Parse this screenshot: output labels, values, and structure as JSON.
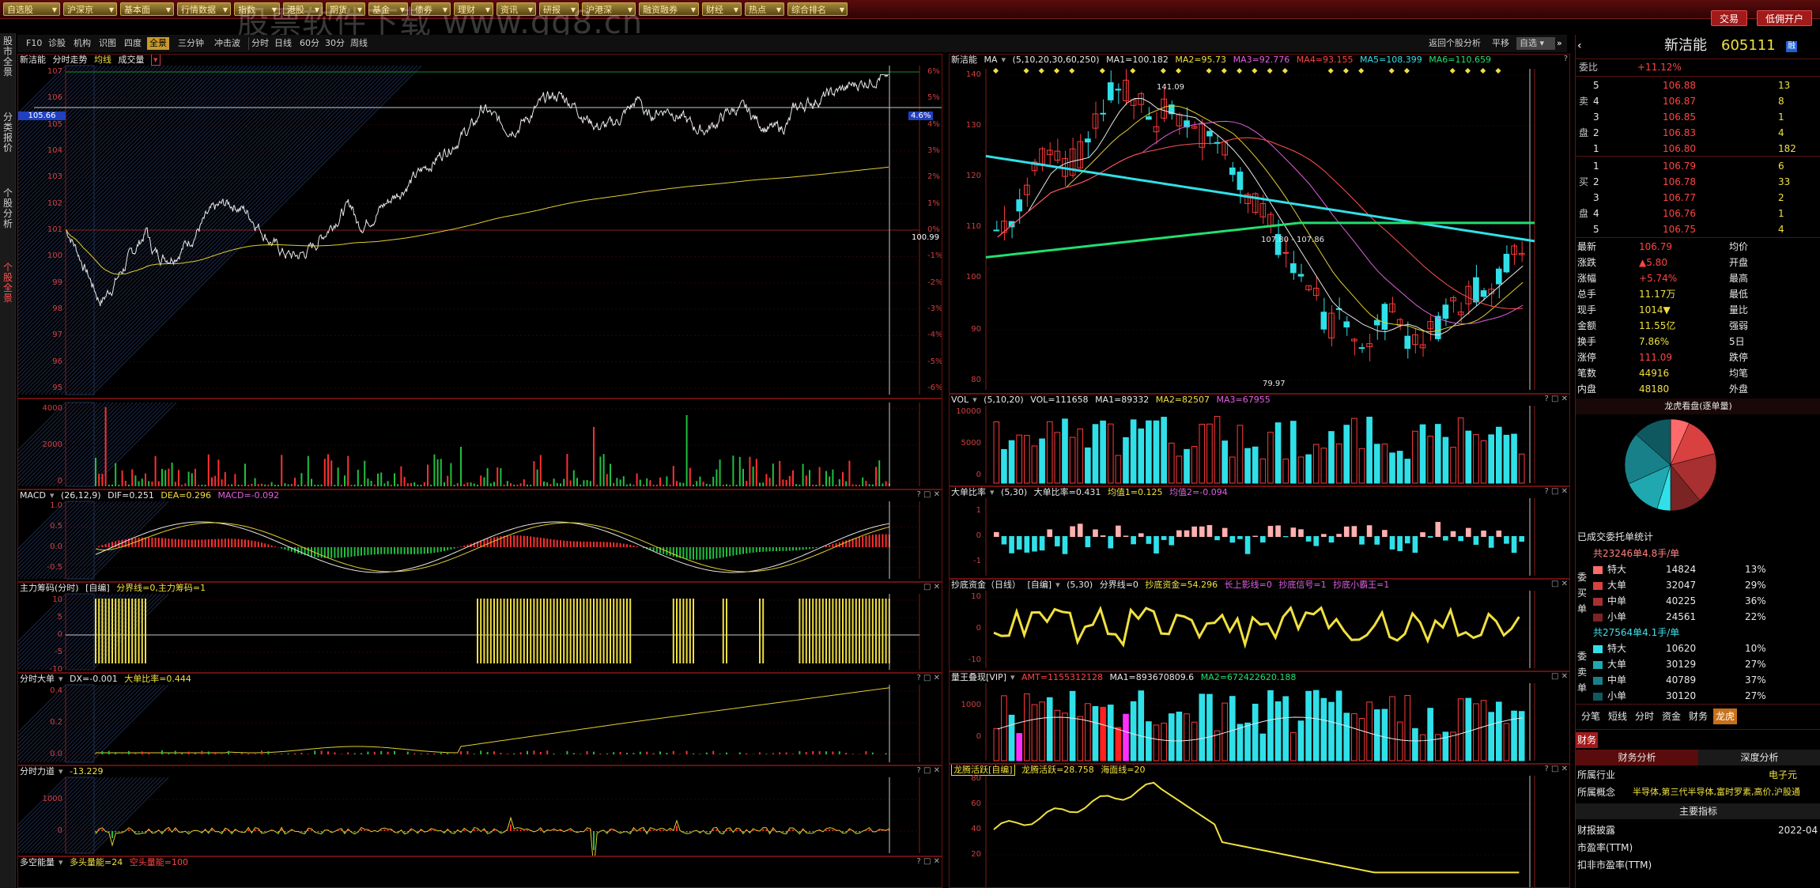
{
  "menubar": {
    "items": [
      "自选股",
      "沪深京",
      "基本面",
      "行情数据",
      "指数",
      "港股",
      "期货",
      "基金",
      "债券",
      "理财",
      "资讯",
      "研报",
      "沪港深",
      "融资融券",
      "财经",
      "热点",
      "综合排名"
    ],
    "watermark": "股票软件下载 www.gg8.cn",
    "trade_button": "交易",
    "lowfee_button": "低佣开户"
  },
  "left_tabs": [
    "股市全景",
    "分类报价",
    "个股分析",
    "个股全景"
  ],
  "toolbar": {
    "items": [
      "F10",
      "诊股",
      "机构",
      "识图",
      "四度",
      "全景",
      "三分钟",
      "冲击波",
      "分时",
      "日线",
      "60分",
      "30分",
      "周线"
    ],
    "active": "全景",
    "right_items": [
      "返回个股分析",
      "平移",
      "自选"
    ]
  },
  "intraday_panel": {
    "title_stock": "新洁能",
    "title_parts": [
      "分时走势",
      "均线",
      "成交量"
    ],
    "price_ticks": [
      "107",
      "106",
      "105",
      "104",
      "103",
      "102",
      "101",
      "100",
      "99",
      "98",
      "97",
      "96",
      "95"
    ],
    "pct_ticks": [
      "6%",
      "5%",
      "4%",
      "3%",
      "2%",
      "1%",
      "0%",
      "-1%",
      "-2%",
      "-3%",
      "-4%",
      "-5%",
      "-6%"
    ],
    "left_marker": "105.66",
    "right_marker": "4.6%",
    "prev_close_label": "100.99"
  },
  "intraday_volume": {
    "ticks": [
      "4000",
      "2000",
      "0"
    ]
  },
  "intraday_macd": {
    "name": "MACD",
    "params": "(26,12,9)",
    "dif": "DIF=0.251",
    "dea": "DEA=0.296",
    "macd": "MACD=-0.092",
    "ticks": [
      "1.0",
      "0.5",
      "0.0",
      "-0.5"
    ]
  },
  "zhuli_panel": {
    "name": "主力筹码(分时)",
    "tag": "[自编]",
    "values": "分界线=0,主力筹码=1",
    "ticks": [
      "10",
      "5",
      "0",
      "-5",
      "-10"
    ]
  },
  "dadan_panel": {
    "name": "分时大单",
    "values": "DX=-0.001",
    "ratio": "大单比率=0.444",
    "ticks": [
      "0.4",
      "0.2",
      "0.0"
    ]
  },
  "force_panel": {
    "name": "分时力道",
    "values": "-13.229",
    "ticks": [
      "1000",
      "0"
    ]
  },
  "energy_panel": {
    "name": "多空能量",
    "long": "多头量能=24",
    "short": "空头量能=100"
  },
  "kline_panel": {
    "stock": "新洁能",
    "ma_label": "MA",
    "ma_params": "(5,10,20,30,60,250)",
    "mas": [
      "MA1=100.182",
      "MA2=95.73",
      "MA3=92.776",
      "MA4=93.155",
      "MA5=108.399",
      "MA6=110.659"
    ],
    "ticks": [
      "140",
      "130",
      "120",
      "110",
      "100",
      "90",
      "80"
    ],
    "high_label": "141.09",
    "low_label": "79.97",
    "range_label": "107.80 - 107.86"
  },
  "vol_panel": {
    "name": "VOL",
    "params": "(5,10,20)",
    "values": [
      "VOL=111658",
      "MA1=89332",
      "MA2=82507",
      "MA3=67955"
    ],
    "ticks": [
      "10000",
      "5000",
      "0"
    ]
  },
  "dadanbi_panel": {
    "name": "大单比率",
    "params": "(5,30)",
    "values": [
      "大单比率=0.431",
      "均值1=0.125",
      "均值2=-0.094"
    ],
    "ticks": [
      "1",
      "0",
      "-1"
    ]
  },
  "chaodi_panel": {
    "name": "抄底资金（日线）",
    "tag": "[自编]",
    "params": "(5,30)",
    "values": [
      "分界线=0",
      "抄底资金=54.296",
      "长上影线=0",
      "抄底信号=1",
      "抄底小霸王=1"
    ],
    "ticks": [
      "10",
      "0",
      "-10"
    ]
  },
  "lwhx_panel": {
    "name": "量王叠现[VIP]",
    "values": [
      "AMT=1155312128",
      "MA1=893670809.6",
      "MA2=672422620.188"
    ],
    "ticks": [
      "1000",
      "0"
    ]
  },
  "longteng_panel": {
    "name": "龙腾活跃[自编]",
    "values": [
      "龙腾活跃=28.758",
      "海面线=20"
    ],
    "ticks": [
      "80",
      "60",
      "40",
      "20"
    ]
  },
  "quote": {
    "name": "新洁能",
    "code": "605111",
    "webi_label": "委比",
    "webi_value": "+11.12%",
    "asks": [
      {
        "level": "5",
        "price": "106.88",
        "vol": "13"
      },
      {
        "level": "4",
        "price": "106.87",
        "vol": "8"
      },
      {
        "level": "3",
        "price": "106.85",
        "vol": "1"
      },
      {
        "level": "2",
        "price": "106.83",
        "vol": "4"
      },
      {
        "level": "1",
        "price": "106.80",
        "vol": "182"
      }
    ],
    "bids": [
      {
        "level": "1",
        "price": "106.79",
        "vol": "6"
      },
      {
        "level": "2",
        "price": "106.78",
        "vol": "33"
      },
      {
        "level": "3",
        "price": "106.77",
        "vol": "2"
      },
      {
        "level": "4",
        "price": "106.76",
        "vol": "1"
      },
      {
        "level": "5",
        "price": "106.75",
        "vol": "4"
      }
    ],
    "ask_side_label": "卖",
    "ask_side_label2": "盘",
    "bid_side_label": "买",
    "bid_side_label2": "盘",
    "stats": [
      {
        "k": "最新",
        "v": "106.79",
        "k2": "均价"
      },
      {
        "k": "涨跌",
        "v": "▲5.80",
        "k2": "开盘"
      },
      {
        "k": "涨幅",
        "v": "+5.74%",
        "k2": "最高"
      },
      {
        "k": "总手",
        "v": "11.17万",
        "k2": "最低"
      },
      {
        "k": "现手",
        "v": "1014▼",
        "k2": "量比"
      },
      {
        "k": "金额",
        "v": "11.55亿",
        "k2": "强弱"
      },
      {
        "k": "换手",
        "v": "7.86%",
        "k2": "5日"
      },
      {
        "k": "涨停",
        "v": "111.09",
        "k2": "跌停"
      },
      {
        "k": "笔数",
        "v": "44916",
        "k2": "均笔"
      },
      {
        "k": "内盘",
        "v": "48180",
        "k2": "外盘"
      }
    ],
    "pie_title": "龙虎看盘(逐单量)",
    "order_stats_title": "已成交委托单统计",
    "buy_total": "共23246单4.8手/单",
    "sell_total": "共27564单4.1手/单",
    "buy_side_labels": [
      "委",
      "买",
      "单"
    ],
    "sell_side_labels": [
      "委",
      "卖",
      "单"
    ],
    "buy_rows": [
      {
        "label": "特大",
        "vol": "14824",
        "pct": "13%",
        "color": "#ff6a6a"
      },
      {
        "label": "大单",
        "vol": "32047",
        "pct": "29%",
        "color": "#d94040"
      },
      {
        "label": "中单",
        "vol": "40225",
        "pct": "36%",
        "color": "#a83030"
      },
      {
        "label": "小单",
        "vol": "24561",
        "pct": "22%",
        "color": "#7a2424"
      }
    ],
    "sell_rows": [
      {
        "label": "特大",
        "vol": "10620",
        "pct": "10%",
        "color": "#30e0e8"
      },
      {
        "label": "大单",
        "vol": "30129",
        "pct": "27%",
        "color": "#20a8b0"
      },
      {
        "label": "中单",
        "vol": "40789",
        "pct": "37%",
        "color": "#188088"
      },
      {
        "label": "小单",
        "vol": "30120",
        "pct": "27%",
        "color": "#105860"
      }
    ],
    "bottom_tabs": [
      "分笔",
      "短线",
      "分时",
      "资金",
      "财务",
      "龙虎"
    ],
    "bottom_active": "龙虎",
    "fin_tab": "财务",
    "fin_subtabs": [
      "财务分析",
      "深度分析"
    ],
    "industry_label": "所属行业",
    "industry_value": "电子元",
    "concept_label": "所属概念",
    "concept_value": "半导体,第三代半导体,富时罗素,高价,沪股通",
    "main_index_title": "主要指标",
    "report_label": "财报披露",
    "report_value": "2022-04",
    "pe_label": "市盈率(TTM)",
    "pe2_label": "扣非市盈率(TTM)"
  }
}
